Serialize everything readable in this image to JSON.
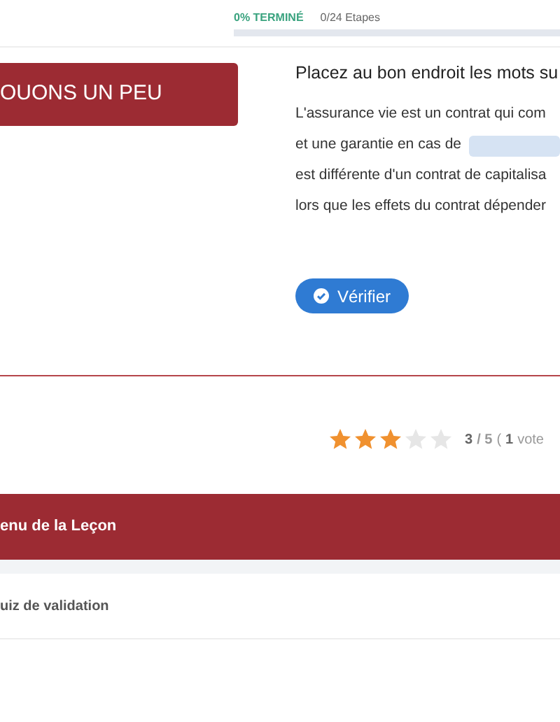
{
  "progress": {
    "percent_label": "0% TERMINÉ",
    "steps": "0/24 Etapes",
    "level": 0
  },
  "banner": {
    "title": "OUONS UN PEU"
  },
  "exercise": {
    "title": "Placez au bon endroit les mots su",
    "lines": [
      {
        "text": "L'assurance vie est un contrat qui com",
        "blank": false
      },
      {
        "text": "et une garantie en cas de",
        "blank": true
      },
      {
        "text": "est différente d'un contrat de capitalisa",
        "blank": false
      },
      {
        "text": "lors que les effets du contrat dépender",
        "blank": false
      }
    ],
    "button": "Vérifier"
  },
  "rating": {
    "stars": 3,
    "score": "3",
    "total": "/ 5",
    "open": "(",
    "votes": "1",
    "vote_word": "vote"
  },
  "lesson": {
    "title": "enu de la Leçon",
    "items": [
      {
        "label": "uiz de validation"
      }
    ]
  }
}
